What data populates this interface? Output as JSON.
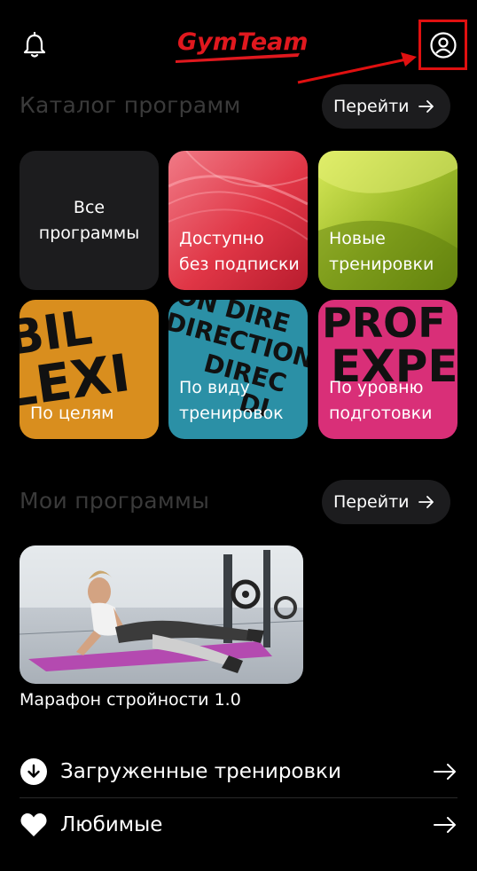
{
  "header": {
    "logo_text": "GymTeam",
    "logo_color": "#e0181e",
    "annotation_color": "#e01010"
  },
  "catalog": {
    "title": "Каталог программ",
    "go_label": "Перейти",
    "tiles": [
      {
        "label": "Все\nпрограммы"
      },
      {
        "label": "Доступно\nбез подписки"
      },
      {
        "label": "Новые\nтренировки"
      },
      {
        "label": "По целям"
      },
      {
        "label": "По виду\nтренировок"
      },
      {
        "label": "По уровню\nподготовки"
      }
    ]
  },
  "my_programs": {
    "title": "Мои программы",
    "go_label": "Перейти",
    "program_title": "Марафон стройности 1.0"
  },
  "links": {
    "downloads": "Загруженные тренировки",
    "favorites": "Любимые"
  }
}
